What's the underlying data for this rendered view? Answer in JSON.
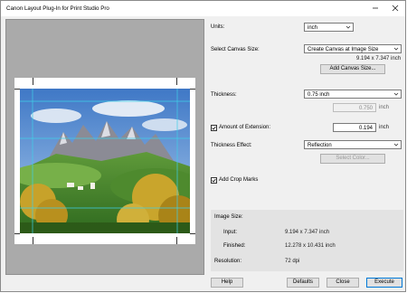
{
  "window": {
    "title": "Canon Layout Plug-In for Print Studio Pro"
  },
  "preview": {
    "photo_alt": "mountain landscape"
  },
  "settings": {
    "units_label": "Units:",
    "units_value": "inch",
    "canvas_size_label": "Select Canvas Size:",
    "canvas_size_value": "Create Canvas at Image Size",
    "canvas_dims": "9.194 x 7.347 inch",
    "add_canvas_button": "Add Canvas Size...",
    "thickness_label": "Thickness:",
    "thickness_value": "0.75 inch",
    "thickness_field": "0.750",
    "thickness_unit": "inch",
    "extension_label": "Amount of Extension:",
    "extension_value": "0.194",
    "extension_unit": "inch",
    "thickness_effect_label": "Thickness Effect:",
    "thickness_effect_value": "Reflection",
    "select_color_button": "Select Color...",
    "crop_marks_label": "Add Crop Marks"
  },
  "image_size": {
    "heading": "Image Size:",
    "input_label": "Input:",
    "input_value": "9.194 x 7.347 inch",
    "finished_label": "Finished:",
    "finished_value": "12.278 x 10.431 inch",
    "resolution_label": "Resolution:",
    "resolution_value": "72 dpi"
  },
  "buttons": {
    "help": "Help",
    "defaults": "Defaults",
    "close": "Close",
    "execute": "Execute"
  }
}
